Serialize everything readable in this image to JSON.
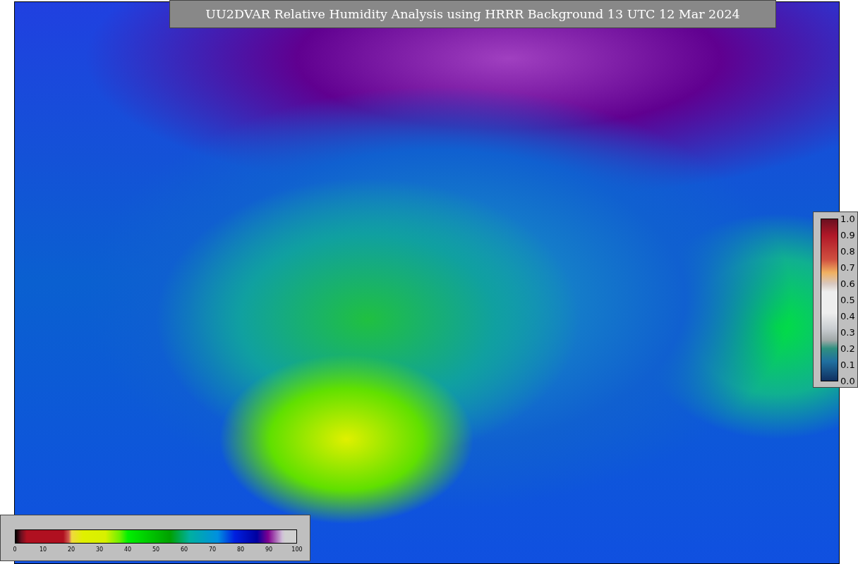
{
  "title": "UU2DVAR Relative Humidity Analysis using HRRR Background 13 UTC 12 Mar 2024",
  "humidity_colorbar": {
    "ticks": [
      "0",
      "10",
      "20",
      "30",
      "40",
      "50",
      "60",
      "70",
      "80",
      "90",
      "100"
    ]
  },
  "observation_colorbar": {
    "ticks": [
      "1.0",
      "0.9",
      "0.8",
      "0.7",
      "0.6",
      "0.5",
      "0.4",
      "0.3",
      "0.2",
      "0.1",
      "0.0"
    ]
  }
}
